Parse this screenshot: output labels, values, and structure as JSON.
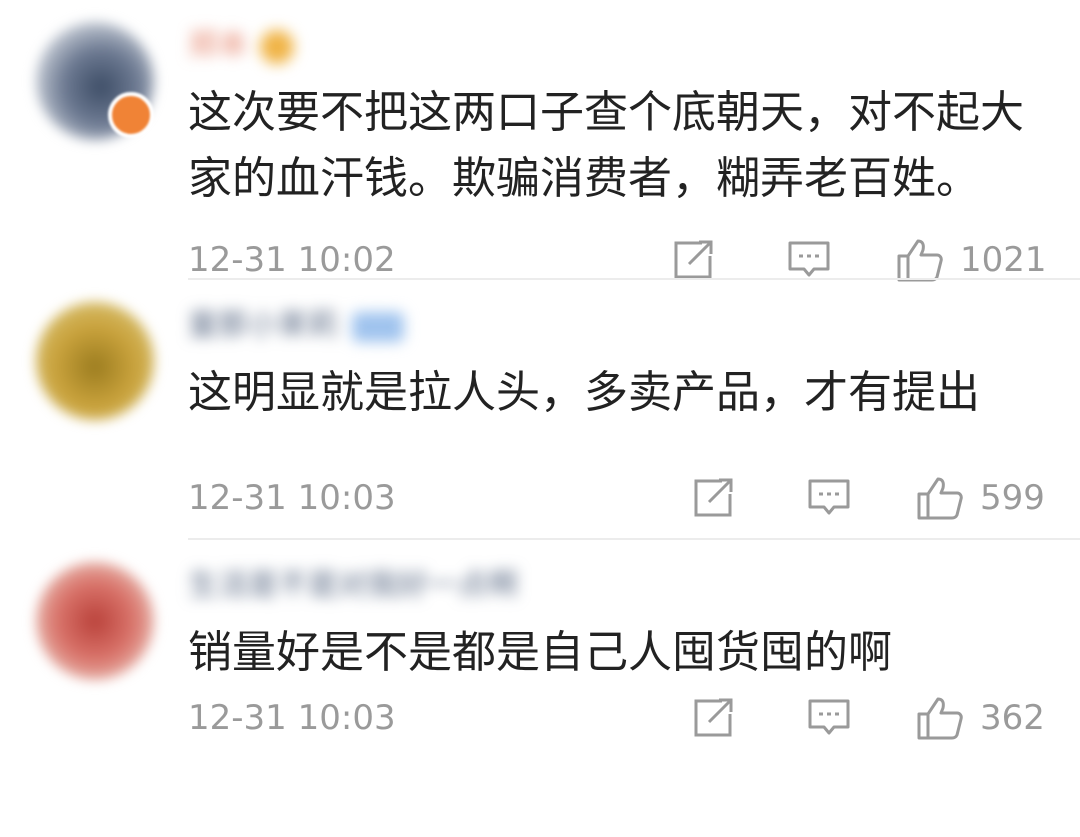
{
  "comments": [
    {
      "username": "郑本",
      "text": "这次要不把这两口子查个底朝天，对不起大家的血汗钱。欺骗消费者，糊弄老百姓。",
      "timestamp": "12-31 10:02",
      "likes": "1021"
    },
    {
      "username": "童那小茉莉",
      "text": "这明显就是拉人头，多卖产品，才有提出",
      "timestamp": "12-31 10:03",
      "likes": "599"
    },
    {
      "username": "生活是不是对我好一点啊",
      "text": "销量好是不是都是自己人囤货囤的啊",
      "timestamp": "12-31 10:03",
      "likes": "362"
    }
  ],
  "icons": {
    "share": "share-icon",
    "reply": "comment-bubble-icon",
    "like": "thumbs-up-icon"
  },
  "colors": {
    "text": "#222222",
    "meta": "#9a9a9a",
    "divider": "#ececec",
    "badge": "#f08336"
  }
}
